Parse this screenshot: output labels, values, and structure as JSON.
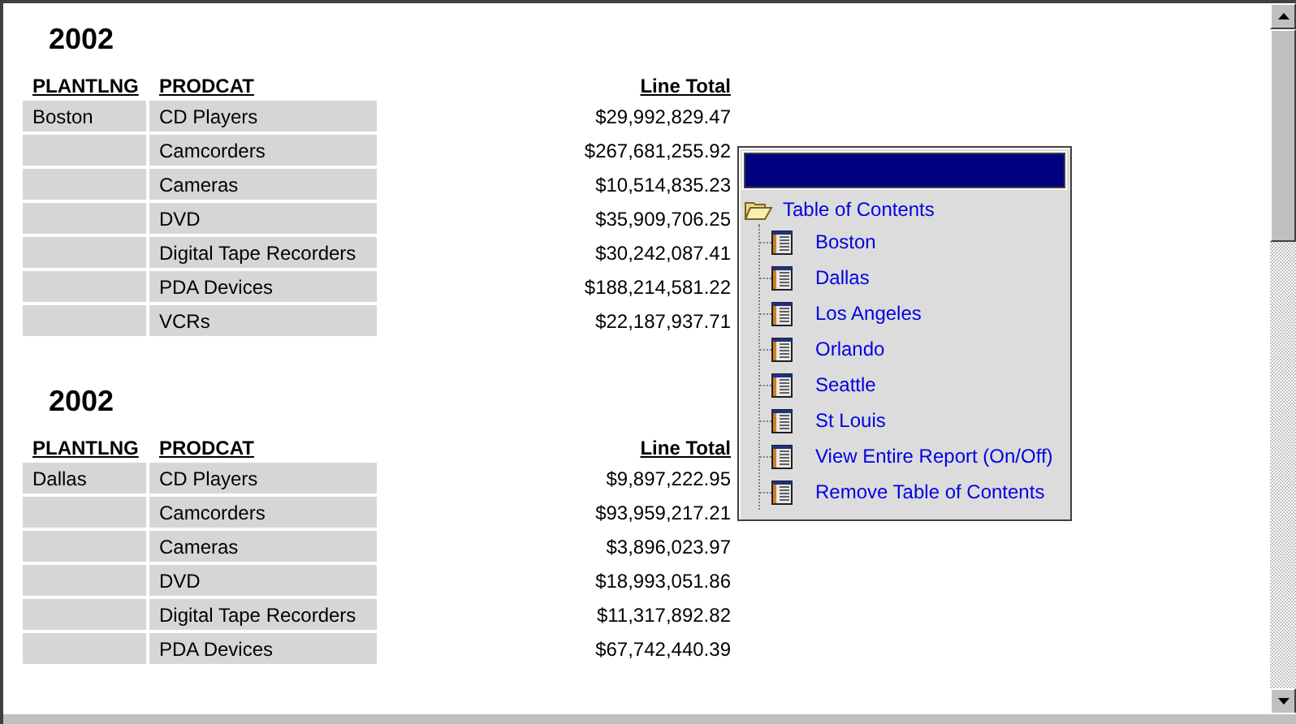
{
  "sections": [
    {
      "year": "2002",
      "columns": [
        "PLANTLNG",
        "PRODCAT",
        "Line Total"
      ],
      "rows": [
        {
          "plant": "Boston",
          "category": "CD Players",
          "total": "$29,992,829.47"
        },
        {
          "category": "Camcorders",
          "total": "$267,681,255.92"
        },
        {
          "category": "Cameras",
          "total": "$10,514,835.23"
        },
        {
          "category": "DVD",
          "total": "$35,909,706.25"
        },
        {
          "category": "Digital Tape Recorders",
          "total": "$30,242,087.41"
        },
        {
          "category": "PDA Devices",
          "total": "$188,214,581.22"
        },
        {
          "category": "VCRs",
          "total": "$22,187,937.71"
        }
      ]
    },
    {
      "year": "2002",
      "columns": [
        "PLANTLNG",
        "PRODCAT",
        "Line Total"
      ],
      "rows": [
        {
          "plant": "Dallas",
          "category": "CD Players",
          "total": "$9,897,222.95"
        },
        {
          "category": "Camcorders",
          "total": "$93,959,217.21"
        },
        {
          "category": "Cameras",
          "total": "$3,896,023.97"
        },
        {
          "category": "DVD",
          "total": "$18,993,051.86"
        },
        {
          "category": "Digital Tape Recorders",
          "total": "$11,317,892.82"
        },
        {
          "category": "PDA Devices",
          "total": "$67,742,440.39"
        }
      ]
    }
  ],
  "toc": {
    "title": "Table of Contents",
    "items": [
      "Boston",
      "Dallas",
      "Los Angeles",
      "Orlando",
      "Seattle",
      "St Louis",
      "View Entire Report (On/Off)",
      "Remove Table of Contents"
    ]
  }
}
